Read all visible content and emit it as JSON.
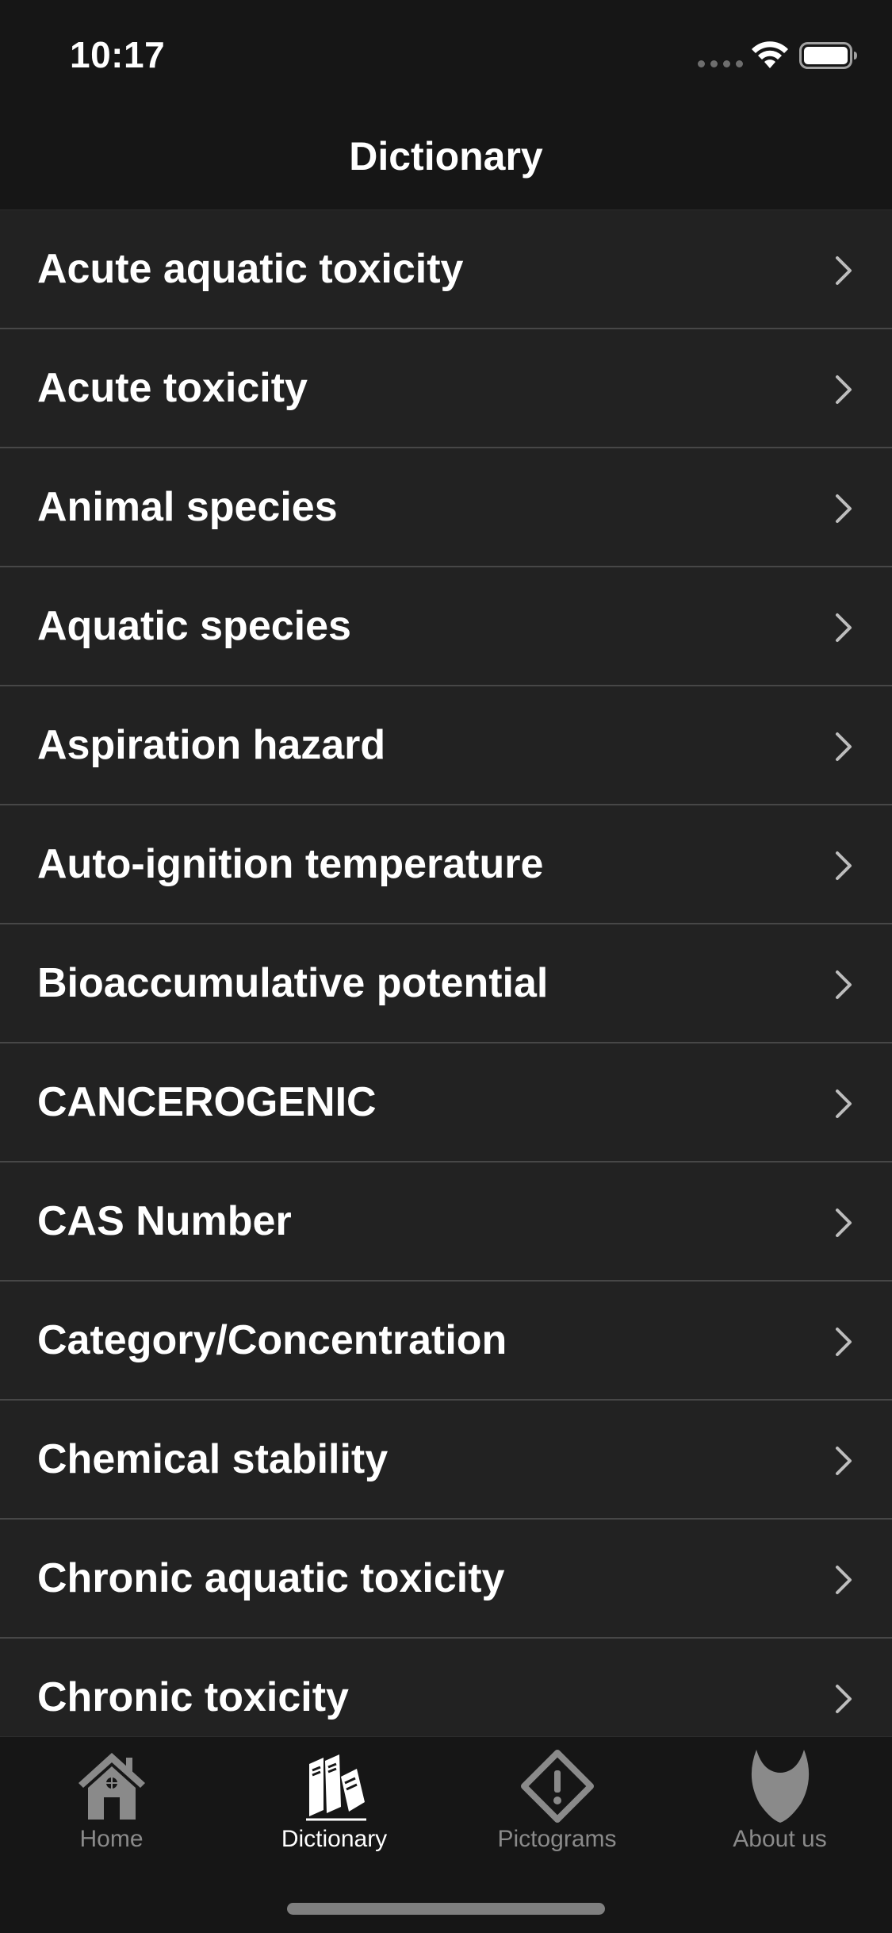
{
  "status_bar": {
    "time": "10:17"
  },
  "nav": {
    "title": "Dictionary"
  },
  "list": {
    "items": [
      {
        "label": "Acute aquatic toxicity"
      },
      {
        "label": "Acute toxicity"
      },
      {
        "label": "Animal species"
      },
      {
        "label": "Aquatic species"
      },
      {
        "label": "Aspiration hazard"
      },
      {
        "label": "Auto-ignition temperature"
      },
      {
        "label": "Bioaccumulative potential"
      },
      {
        "label": "CANCEROGENIC"
      },
      {
        "label": "CAS Number"
      },
      {
        "label": "Category/Concentration"
      },
      {
        "label": "Chemical stability"
      },
      {
        "label": "Chronic aquatic toxicity"
      },
      {
        "label": "Chronic toxicity"
      }
    ]
  },
  "tab_bar": {
    "tabs": [
      {
        "label": "Home",
        "icon": "house-icon",
        "active": false
      },
      {
        "label": "Dictionary",
        "icon": "books-icon",
        "active": true
      },
      {
        "label": "Pictograms",
        "icon": "warning-diamond-icon",
        "active": false
      },
      {
        "label": "About us",
        "icon": "shield-logo-icon",
        "active": false
      }
    ]
  },
  "colors": {
    "background": "#1a1a1a",
    "row_background": "#222222",
    "separator": "#474747",
    "inactive_tab": "#8a8a8a",
    "active_tab": "#ffffff"
  }
}
